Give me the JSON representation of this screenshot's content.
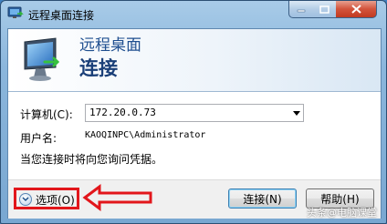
{
  "window": {
    "title": "远程桌面连接"
  },
  "header": {
    "title": "远程桌面",
    "subtitle": "连接"
  },
  "form": {
    "computer_label": "计算机(C):",
    "computer_value": "172.20.0.73",
    "username_label": "用户名:",
    "username_value": "KAOQINPC\\Administrator",
    "note": "当您连接时将向您询问凭据。"
  },
  "footer": {
    "options_label": "选项(O)",
    "connect_label": "连接(N)",
    "help_label": "帮助(H)"
  },
  "watermark": "头条@电脑课堂",
  "icons": {
    "app": "remote-desktop-icon",
    "header": "monitor-connection-icon",
    "options": "chevron-down-icon",
    "annotation": "left-arrow-icon"
  },
  "colors": {
    "title_blue": "#1e4e8f",
    "annotation_red": "#e2161b",
    "close_red": "#c23a20"
  }
}
